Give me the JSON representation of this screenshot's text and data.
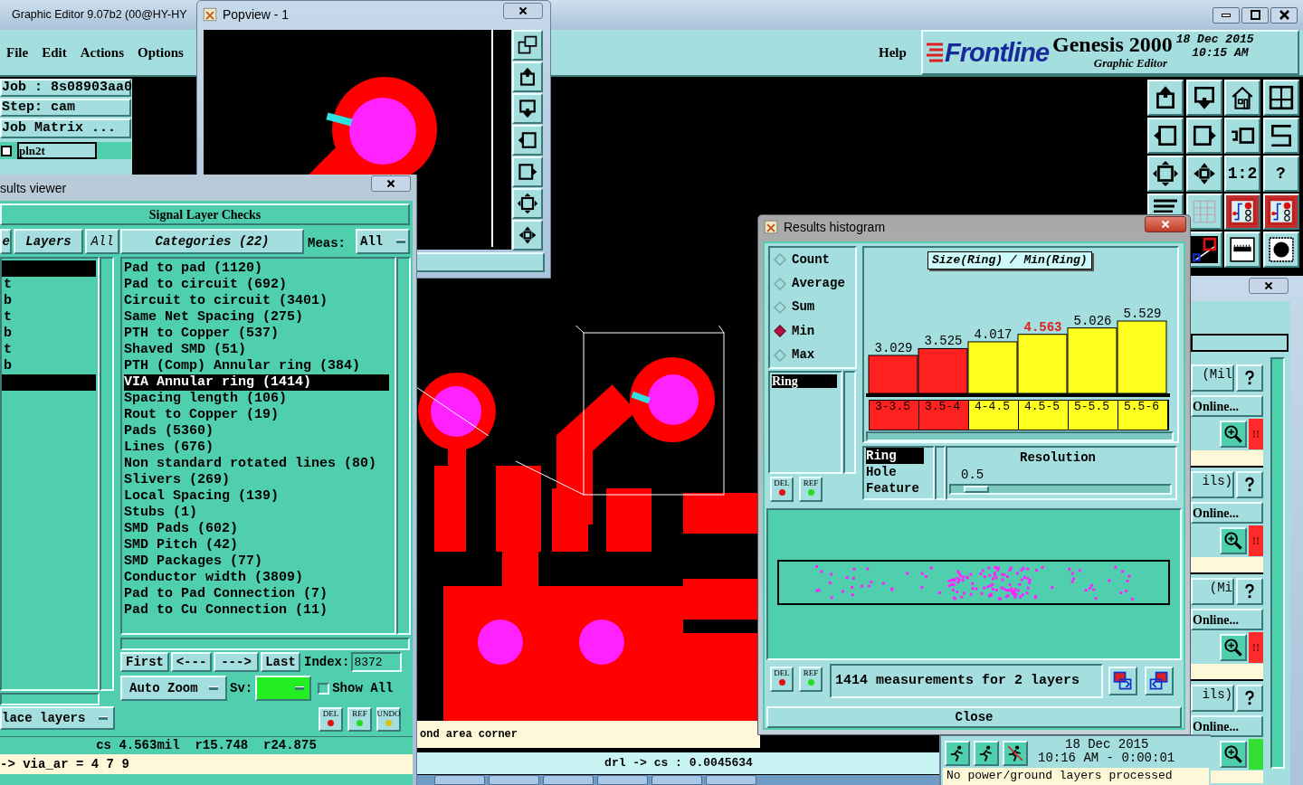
{
  "main_window": {
    "title": "Graphic Editor 9.07b2 (00@HY-HY",
    "menu": [
      "File",
      "Edit",
      "Actions",
      "Options"
    ],
    "help": "Help",
    "brand": {
      "logo": "Frontline",
      "product": "Genesis 2000",
      "subtitle": "Graphic Editor",
      "date": "18 Dec 2015",
      "time": "10:15 AM"
    },
    "job": {
      "job": "Job : 8s08903aa0",
      "step": "Step: cam",
      "matrix_button": "Job Matrix ...",
      "layers": [
        {
          "name": "pln2t",
          "checked": false
        }
      ]
    },
    "toolbar": [
      {
        "kind": "upload"
      },
      {
        "kind": "download"
      },
      {
        "kind": "home"
      },
      {
        "kind": "gridxy"
      },
      {
        "kind": "left"
      },
      {
        "kind": "right"
      },
      {
        "kind": "undo"
      },
      {
        "kind": "scurve"
      },
      {
        "kind": "fit"
      },
      {
        "kind": "center"
      },
      {
        "kind": "text",
        "text": "1:2"
      },
      {
        "kind": "text",
        "text": "?"
      },
      {
        "kind": "tools"
      },
      {
        "kind": "grid"
      },
      {
        "kind": "board"
      },
      {
        "kind": "board"
      },
      {
        "kind": "diag"
      },
      {
        "kind": "ruler"
      },
      {
        "kind": "dot"
      }
    ],
    "canvas": {
      "message": "ond area corner",
      "readout": "drl -> cs : 0.0045634"
    }
  },
  "popview": {
    "title": "Popview - 1",
    "tools": [
      {
        "kind": "copy"
      },
      {
        "kind": "upload"
      },
      {
        "kind": "download"
      },
      {
        "kind": "left"
      },
      {
        "kind": "right"
      },
      {
        "kind": "fit"
      },
      {
        "kind": "center"
      }
    ]
  },
  "results_viewer": {
    "title": "sults viewer",
    "heading": "Signal Layer Checks",
    "tabs": [
      {
        "label": "e"
      },
      {
        "label": "Layers"
      },
      {
        "label": "All"
      }
    ],
    "layers": [
      {
        "selected": true
      },
      {
        "label": "t",
        "selected": false
      },
      {
        "label": "b",
        "selected": false
      },
      {
        "label": "t",
        "selected": false
      },
      {
        "label": "b",
        "selected": false
      },
      {
        "label": "t",
        "selected": false
      },
      {
        "label": "b",
        "selected": false
      },
      {
        "selected": true
      }
    ],
    "categories_header": "Categories (22)",
    "meas_label": "Meas:",
    "meas_value": "All",
    "categories": [
      {
        "label": "Pad to pad (1120)",
        "selected": false
      },
      {
        "label": "Pad to circuit (692)",
        "selected": false
      },
      {
        "label": "Circuit to circuit (3401)",
        "selected": false
      },
      {
        "label": "Same Net Spacing (275)",
        "selected": false
      },
      {
        "label": "PTH to Copper (537)",
        "selected": false
      },
      {
        "label": "Shaved SMD (51)",
        "selected": false
      },
      {
        "label": "PTH (Comp) Annular ring (384)",
        "selected": false
      },
      {
        "label": "VIA Annular ring (1414)",
        "selected": true
      },
      {
        "label": "Spacing length (106)",
        "selected": false
      },
      {
        "label": "Rout to Copper (19)",
        "selected": false
      },
      {
        "label": "Pads (5360)",
        "selected": false
      },
      {
        "label": "Lines (676)",
        "selected": false
      },
      {
        "label": "Non standard rotated lines (80)",
        "selected": false
      },
      {
        "label": "Slivers (269)",
        "selected": false
      },
      {
        "label": "Local Spacing (139)",
        "selected": false
      },
      {
        "label": "Stubs (1)",
        "selected": false
      },
      {
        "label": "SMD Pads (602)",
        "selected": false
      },
      {
        "label": "SMD Pitch (42)",
        "selected": false
      },
      {
        "label": "SMD Packages (77)",
        "selected": false
      },
      {
        "label": "Conductor width (3809)",
        "selected": false
      },
      {
        "label": "Pad to Pad Connection (7)",
        "selected": false
      },
      {
        "label": "Pad to Cu Connection (11)",
        "selected": false
      }
    ],
    "nav_buttons": [
      "First",
      "<---",
      "--->",
      "Last"
    ],
    "index_label": "Index:",
    "index_value": "8372",
    "zoom_dropdown": "Auto Zoom",
    "sv": {
      "label": "Sv:",
      "color": "#22ee22"
    },
    "show_all": {
      "label": "Show All",
      "checked": false
    },
    "layers_dropdown": "lace layers",
    "action_buttons": [
      "DEL",
      "REF",
      "UNDO"
    ],
    "status": "cs 4.563mil  r15.748  r24.875",
    "command": "-> via_ar = 4 7 9"
  },
  "histogram": {
    "title": "Results histogram",
    "modes": [
      {
        "label": "Count",
        "selected": false
      },
      {
        "label": "Average",
        "selected": false
      },
      {
        "label": "Sum",
        "selected": false
      },
      {
        "label": "Min",
        "selected": true
      },
      {
        "label": "Max",
        "selected": false
      }
    ],
    "attributes": [
      {
        "label": "Ring",
        "selected": true
      }
    ],
    "chart_data": {
      "type": "bar",
      "title": "Size(Ring) / Min(Ring)",
      "categories": [
        "3-3.5",
        "3.5-4",
        "4-4.5",
        "4.5-5",
        "5-5.5",
        "5.5-6"
      ],
      "values": [
        3.029,
        3.525,
        4.017,
        4.563,
        5.026,
        5.529
      ],
      "data_labels": true
    },
    "bins": [
      {
        "color": "#ff2020",
        "highlighted": false
      },
      {
        "color": "#ff2020",
        "highlighted": false
      },
      {
        "color": "#ffff20",
        "highlighted": false
      },
      {
        "color": "#ffff20",
        "highlighted": true
      },
      {
        "color": "#ffff20",
        "highlighted": false
      },
      {
        "color": "#ffff20",
        "highlighted": false
      }
    ],
    "fields": [
      {
        "label": "Ring",
        "selected": true
      },
      {
        "label": "Hole",
        "selected": false
      },
      {
        "label": "Feature",
        "selected": false
      }
    ],
    "resolution_label": "Resolution",
    "resolution_value": "0.5",
    "resolution": {
      "level": 0.06
    },
    "list_buttons": [
      "DEL",
      "REF"
    ],
    "footer_buttons": [
      "DEL",
      "REF"
    ],
    "summary": "1414 measurements for 2 layers",
    "close": "Close"
  },
  "side_panel": {
    "sections": [
      {
        "label": "(Mil",
        "button": "Online...",
        "flag": "!!",
        "color": "#ff2a2a"
      },
      {
        "label": "ils)",
        "button": "Online...",
        "flag": "!!",
        "color": "#ff2a2a"
      },
      {
        "label": "(Mi",
        "button": "Online...",
        "flag": "!!",
        "color": "#ff2a2a"
      },
      {
        "label": "ils)",
        "button": "Online...",
        "color": "#33dd33"
      }
    ]
  },
  "status_window": {
    "date": "18 Dec 2015",
    "time": "10:16 AM - 0:00:01",
    "message": "No power/ground layers processed"
  }
}
